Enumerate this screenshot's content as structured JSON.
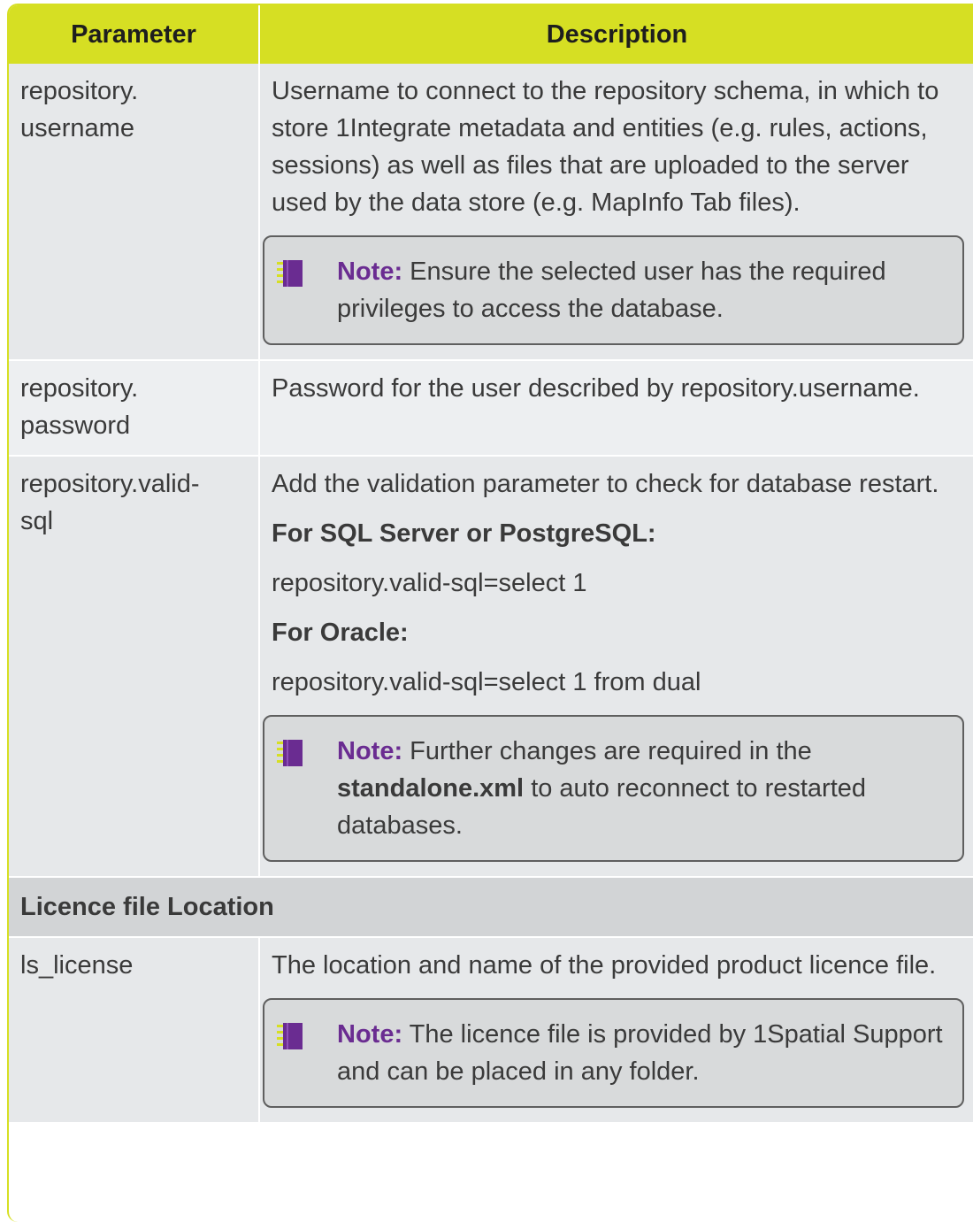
{
  "header": {
    "parameter": "Parameter",
    "description": "Description"
  },
  "rows": [
    {
      "param": "repository.\nusername",
      "param_line1": "repository.",
      "param_line2": "username",
      "description": "Username to connect to the repository schema, in which to store 1Integrate metadata and entities (e.g. rules, actions, sessions) as well as files that are uploaded to the server used by the data store (e.g. MapInfo Tab files).",
      "note_label": "Note:",
      "note_text": "Ensure the selected user has the required privileges to access the database."
    },
    {
      "param_line1": "repository.",
      "param_line2": "password",
      "description": "Password for the user described by repository.username."
    },
    {
      "param_line1": "repository.valid-",
      "param_line2": "sql",
      "description": "Add the validation parameter to check for database restart.",
      "subhead1": "For SQL Server or PostgreSQL:",
      "code1": "repository.valid-sql=select 1",
      "subhead2": "For Oracle:",
      "code2": "repository.valid-sql=select 1 from dual",
      "note_label": "Note:",
      "note_text_before": "Further changes are required in the",
      "note_strong": "standalone.xml",
      "note_text_after": "to auto reconnect to restarted databases."
    }
  ],
  "section": {
    "title": "Licence file Location"
  },
  "license_row": {
    "param": "ls_license",
    "description": "The location and name of the provided product licence file.",
    "note_label": "Note:",
    "note_text": "The licence file is provided by 1Spatial Support and can be placed in any folder."
  },
  "colors": {
    "header_accent": "#d6df23",
    "note_label": "#6a2c91"
  },
  "icons": {
    "note": "notepad-icon"
  }
}
